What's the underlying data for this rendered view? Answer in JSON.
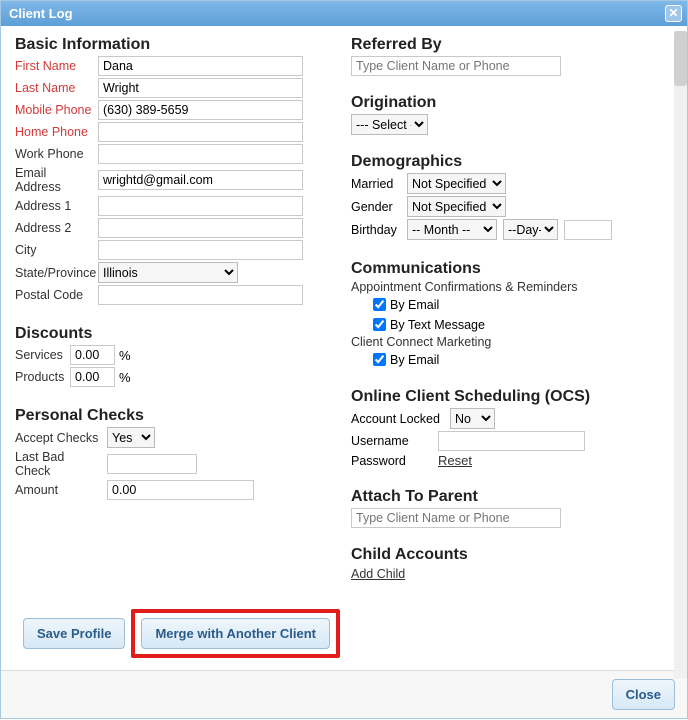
{
  "window": {
    "title": "Client Log"
  },
  "basic": {
    "header": "Basic Information",
    "first_name_label": "First Name",
    "first_name": "Dana",
    "last_name_label": "Last Name",
    "last_name": "Wright",
    "mobile_label": "Mobile Phone",
    "mobile": "(630) 389-5659",
    "home_label": "Home Phone",
    "home": "",
    "work_label": "Work Phone",
    "work": "",
    "email_label": "Email Address",
    "email": "wrightd@gmail.com",
    "addr1_label": "Address 1",
    "addr1": "",
    "addr2_label": "Address 2",
    "addr2": "",
    "city_label": "City",
    "city": "",
    "state_label": "State/Province",
    "state": "Illinois",
    "postal_label": "Postal Code",
    "postal": ""
  },
  "discounts": {
    "header": "Discounts",
    "services_label": "Services",
    "services": "0.00",
    "products_label": "Products",
    "products": "0.00",
    "pct": "%"
  },
  "checks": {
    "header": "Personal Checks",
    "accept_label": "Accept Checks",
    "accept": "Yes",
    "lastbad_label": "Last Bad Check",
    "lastbad": "",
    "amount_label": "Amount",
    "amount": "0.00"
  },
  "referred": {
    "header": "Referred By",
    "placeholder": "Type Client Name or Phone"
  },
  "origination": {
    "header": "Origination",
    "value": "--- Select ---"
  },
  "demographics": {
    "header": "Demographics",
    "married_label": "Married",
    "married": "Not Specified",
    "gender_label": "Gender",
    "gender": "Not Specified",
    "birthday_label": "Birthday",
    "month": "-- Month --",
    "day": "--Day--"
  },
  "communications": {
    "header": "Communications",
    "confirm_label": "Appointment Confirmations & Reminders",
    "by_email": "By Email",
    "by_text": "By Text Message",
    "marketing_label": "Client Connect Marketing",
    "by_email2": "By Email"
  },
  "ocs": {
    "header": "Online Client Scheduling (OCS)",
    "locked_label": "Account Locked",
    "locked": "No",
    "username_label": "Username",
    "username": "",
    "password_label": "Password",
    "reset": "Reset"
  },
  "parent": {
    "header": "Attach To Parent",
    "placeholder": "Type Client Name or Phone"
  },
  "child": {
    "header": "Child Accounts",
    "add": "Add Child"
  },
  "buttons": {
    "save": "Save Profile",
    "merge": "Merge with Another Client",
    "close": "Close"
  }
}
